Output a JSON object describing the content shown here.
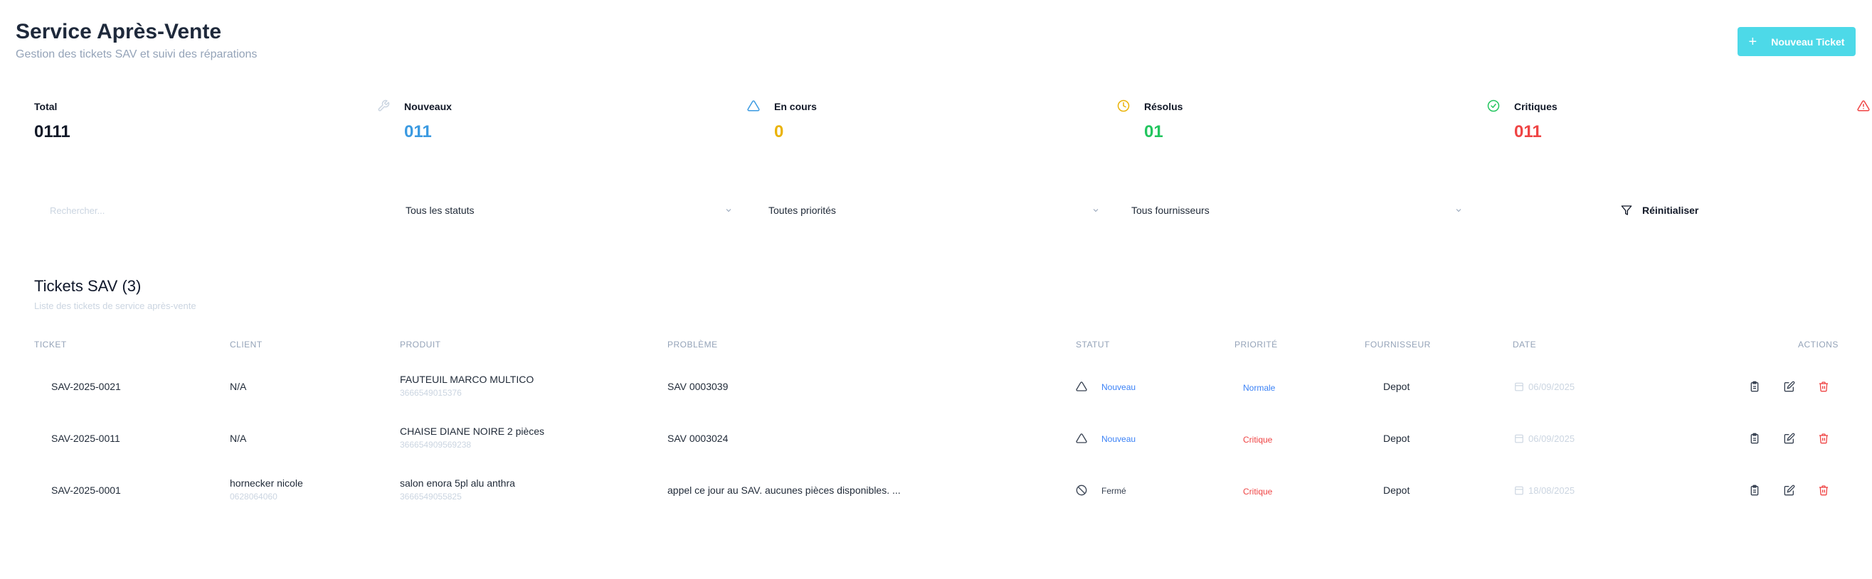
{
  "header": {
    "title": "Service Après-Vente",
    "subtitle": "Gestion des tickets SAV et suivi des réparations",
    "new_ticket_label": "Nouveau Ticket"
  },
  "stats": [
    {
      "label": "Total",
      "value": "0111",
      "color": "#111827",
      "icon": "wrench-icon"
    },
    {
      "label": "Nouveaux",
      "value": "011",
      "color": "#3b9ae1",
      "icon": "warning-icon"
    },
    {
      "label": "En cours",
      "value": "0",
      "color": "#eab308",
      "icon": "clock-icon"
    },
    {
      "label": "Résolus",
      "value": "01",
      "color": "#22c55e",
      "icon": "check-circle-icon"
    },
    {
      "label": "Critiques",
      "value": "011",
      "color": "#ef4444",
      "icon": "alert-triangle-icon"
    }
  ],
  "filters": {
    "search_placeholder": "Rechercher...",
    "status": "Tous les statuts",
    "priority": "Toutes priorités",
    "supplier": "Tous fournisseurs",
    "reset_label": "Réinitialiser"
  },
  "table": {
    "title": "Tickets SAV (3)",
    "subtitle": "Liste des tickets de service après-vente",
    "columns": [
      "Ticket",
      "Client",
      "Produit",
      "Problème",
      "Statut",
      "Priorité",
      "Fournisseur",
      "Date",
      "Actions"
    ],
    "rows": [
      {
        "ticket": "SAV-2025-0021",
        "client": "N/A",
        "client_phone": "",
        "product": "FAUTEUIL MARCO MULTICO",
        "product_code": "3666549015376",
        "problem": "SAV 0003039",
        "status": "Nouveau",
        "status_icon": "warning-triangle-icon",
        "status_color": "#3b82f6",
        "priority": "Normale",
        "priority_color": "#3b82f6",
        "supplier": "Depot",
        "date": "06/09/2025"
      },
      {
        "ticket": "SAV-2025-0011",
        "client": "N/A",
        "client_phone": "",
        "product": "CHAISE DIANE NOIRE 2 pièces",
        "product_code": "366654909569238",
        "problem": "SAV 0003024",
        "status": "Nouveau",
        "status_icon": "warning-triangle-icon",
        "status_color": "#3b82f6",
        "priority": "Critique",
        "priority_color": "#ef4444",
        "supplier": "Depot",
        "date": "06/09/2025"
      },
      {
        "ticket": "SAV-2025-0001",
        "client": "hornecker nicole",
        "client_phone": "0628064060",
        "product": "salon enora 5pl alu anthra",
        "product_code": "3666549055825",
        "problem": "appel ce jour au SAV. aucunes pièces disponibles. ...",
        "status": "Fermé",
        "status_icon": "ban-icon",
        "status_color": "#374151",
        "priority": "Critique",
        "priority_color": "#ef4444",
        "supplier": "Depot",
        "date": "18/08/2025"
      }
    ]
  }
}
